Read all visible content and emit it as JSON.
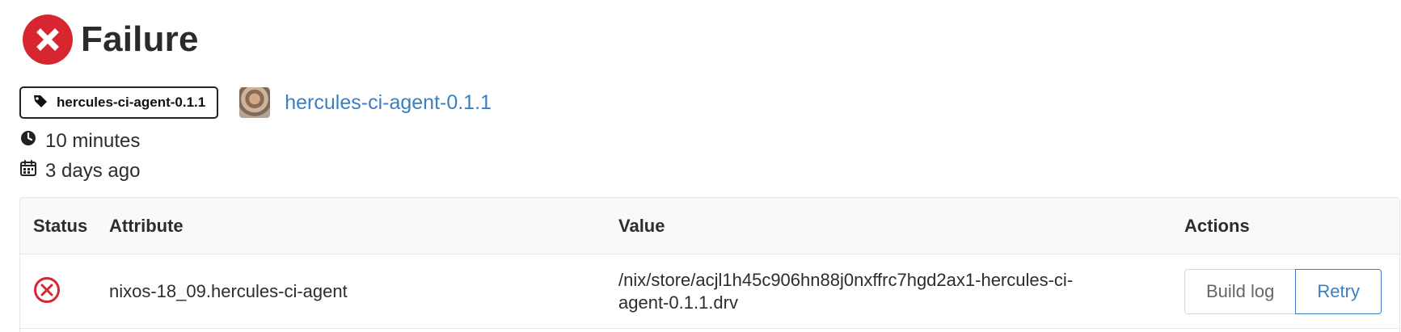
{
  "header": {
    "title": "Failure",
    "status_icon": "x-circle-fill-icon",
    "status_color": "#d7262f"
  },
  "tag": {
    "icon": "tag-icon",
    "label": "hercules-ci-agent-0.1.1"
  },
  "commit": {
    "avatar": "avatar",
    "label": "hercules-ci-agent-0.1.1"
  },
  "meta": {
    "duration": "10 minutes",
    "created": "3 days ago"
  },
  "table": {
    "headers": [
      "Status",
      "Attribute",
      "Value",
      "Actions"
    ],
    "rows": [
      {
        "status_icon": "x-circle-outline-icon",
        "attribute": "nixos-18_09.hercules-ci-agent",
        "value": "/nix/store/acjl1h45c906hn88j0nxffrc7hgd2ax1-hercules-ci-agent-0.1.1.drv",
        "actions": [
          "Build log",
          "Retry"
        ]
      }
    ]
  },
  "colors": {
    "link": "#3b7fc1",
    "error": "#d7262f"
  }
}
